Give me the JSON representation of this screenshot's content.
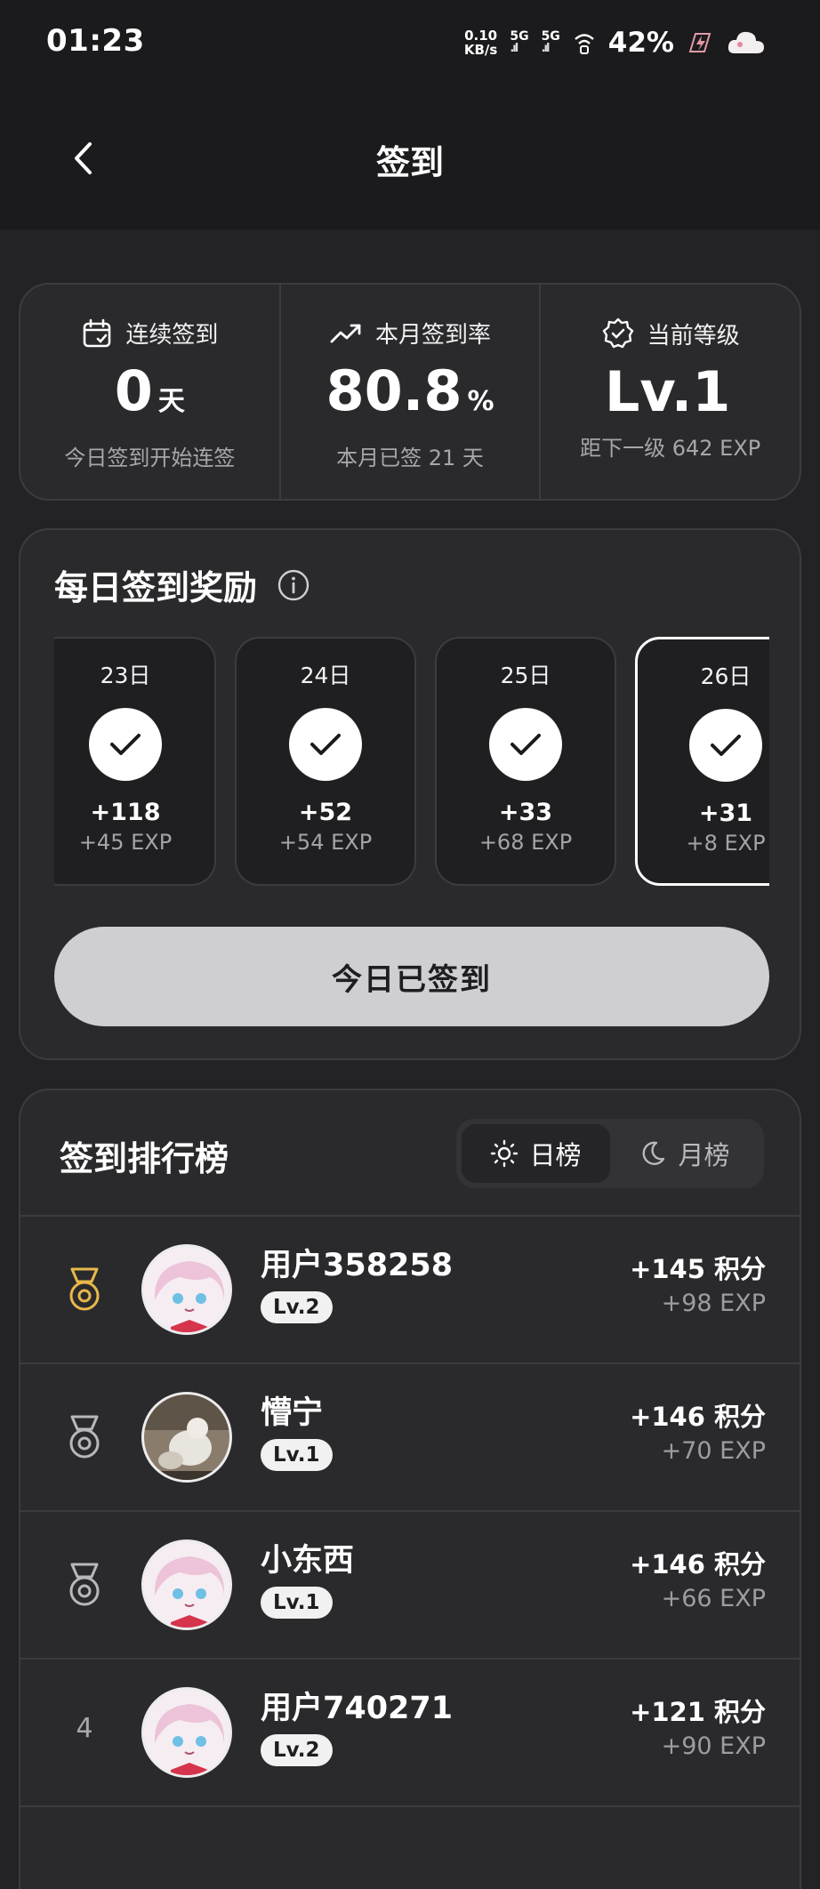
{
  "status_bar": {
    "time": "01:23",
    "speed_value": "0.10",
    "speed_unit": "KB/s",
    "network_1": "5G",
    "network_2": "5G",
    "battery": "42%"
  },
  "header": {
    "title": "签到"
  },
  "stats": [
    {
      "icon": "calendar-check-icon",
      "label": "连续签到",
      "value": "0",
      "unit": "天",
      "sub": "今日签到开始连签"
    },
    {
      "icon": "trending-up-icon",
      "label": "本月签到率",
      "value": "80.8",
      "unit": "%",
      "sub": "本月已签 21 天"
    },
    {
      "icon": "badge-check-icon",
      "label": "当前等级",
      "value": "Lv.1",
      "unit": "",
      "sub": "距下一级 642 EXP"
    }
  ],
  "reward": {
    "title": "每日签到奖励",
    "days": [
      {
        "date": "23日",
        "points": "+118",
        "exp": "+45 EXP",
        "signed": true,
        "today": false
      },
      {
        "date": "24日",
        "points": "+52",
        "exp": "+54 EXP",
        "signed": true,
        "today": false
      },
      {
        "date": "25日",
        "points": "+33",
        "exp": "+68 EXP",
        "signed": true,
        "today": false
      },
      {
        "date": "26日",
        "points": "+31",
        "exp": "+8 EXP",
        "signed": true,
        "today": true
      }
    ],
    "button_label": "今日已签到"
  },
  "ranking": {
    "title": "签到排行榜",
    "tabs": [
      {
        "label": "日榜",
        "icon": "sun-icon",
        "active": true
      },
      {
        "label": "月榜",
        "icon": "moon-icon",
        "active": false
      }
    ],
    "rows": [
      {
        "rank": "1",
        "medal": "gold",
        "name": "用户358258",
        "level": "Lv.2",
        "score": "+145 积分",
        "exp": "+98 EXP"
      },
      {
        "rank": "2",
        "medal": "silver",
        "name": "懵宁",
        "level": "Lv.1",
        "score": "+146 积分",
        "exp": "+70 EXP"
      },
      {
        "rank": "3",
        "medal": "silver",
        "name": "小东西",
        "level": "Lv.1",
        "score": "+146 积分",
        "exp": "+66 EXP"
      },
      {
        "rank": "4",
        "medal": "",
        "name": "用户740271",
        "level": "Lv.2",
        "score": "+121 积分",
        "exp": "+90 EXP"
      }
    ]
  },
  "colors": {
    "background": "#232325",
    "card": "#2a2a2d",
    "border": "#3c3c40",
    "gold": "#e8b84a",
    "silver": "#b8b8bc",
    "button": "#cfcfd1"
  }
}
